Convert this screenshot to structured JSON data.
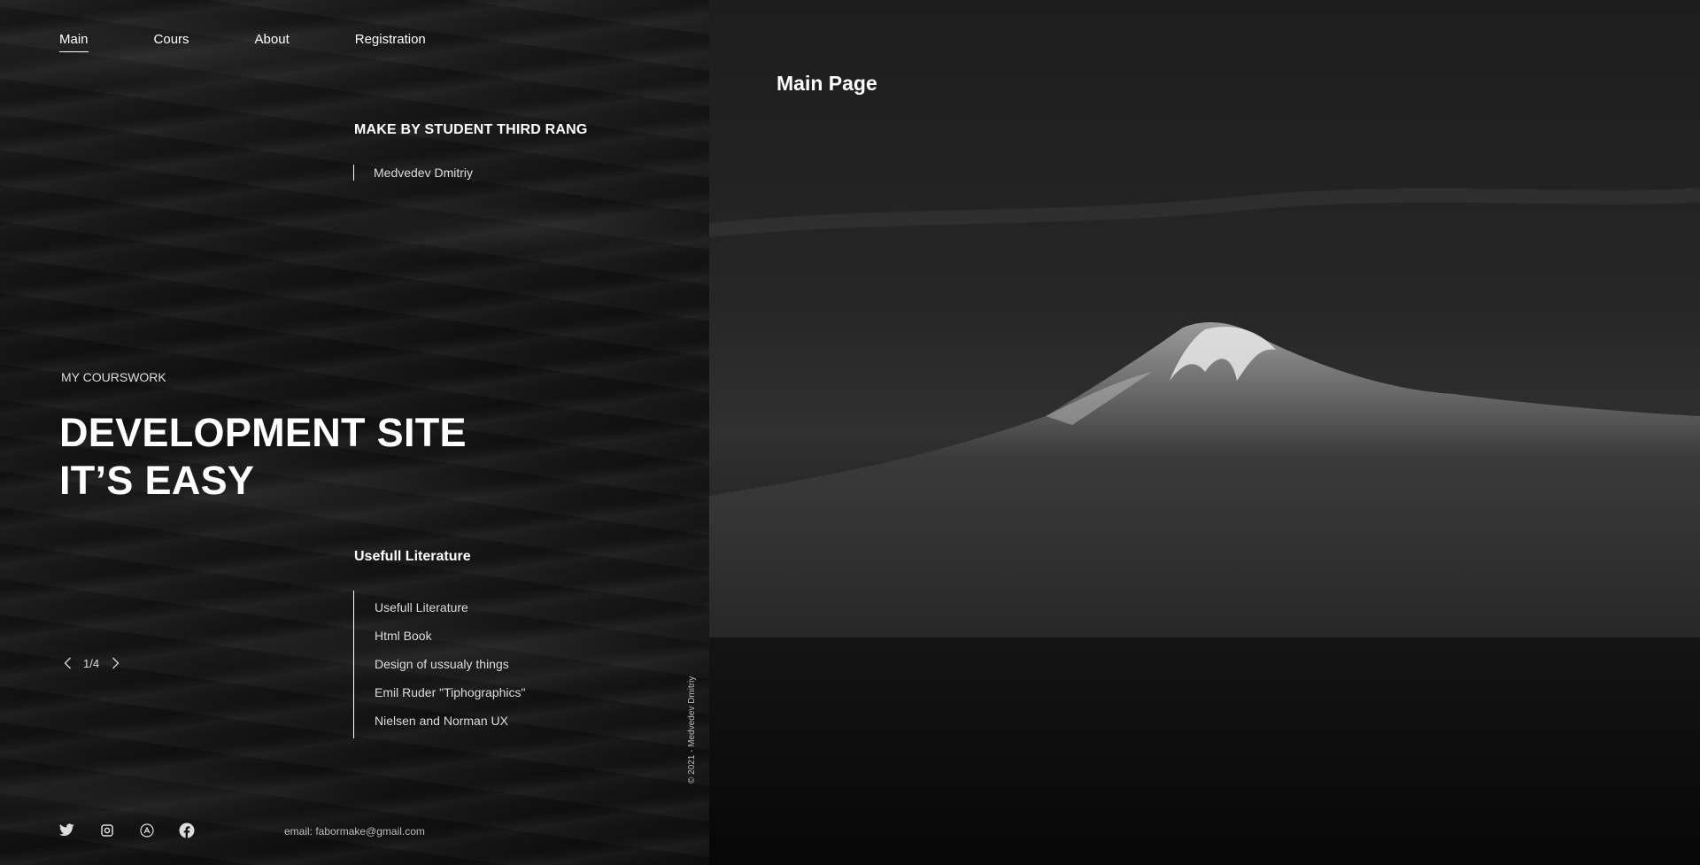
{
  "nav": {
    "items": [
      {
        "label": "Main",
        "active": true
      },
      {
        "label": "Cours",
        "active": false
      },
      {
        "label": "About",
        "active": false
      },
      {
        "label": "Registration",
        "active": false
      }
    ]
  },
  "credits": {
    "title": "MAKE BY STUDENT THIRD RANG",
    "author": "Medvedev Dmitriy"
  },
  "hero": {
    "eyebrow": "MY COURSWORK",
    "line1": "DEVELOPMENT SITE",
    "line2": "IT’S EASY"
  },
  "literature": {
    "title": "Usefull Literature",
    "items": [
      "Usefull Literature",
      "Html Book",
      "Design of ussualy things",
      "Emil Ruder \"Tiphographics\"",
      "Nielsen and Norman UX"
    ]
  },
  "pager": {
    "current": "1/4",
    "prev_icon": "chevron-left-icon",
    "next_icon": "chevron-right-icon"
  },
  "copyright": "© 2021 - Medvedev Dmitriy",
  "socials": [
    "twitter-icon",
    "instagram-icon",
    "app-store-icon",
    "facebook-icon"
  ],
  "email": "email: fabormake@gmail.com",
  "right": {
    "title": "Main Page"
  },
  "colors": {
    "text": "#ffffff",
    "muted": "#dddddd",
    "left_bg": "#161616",
    "right_bg": "#262626"
  }
}
